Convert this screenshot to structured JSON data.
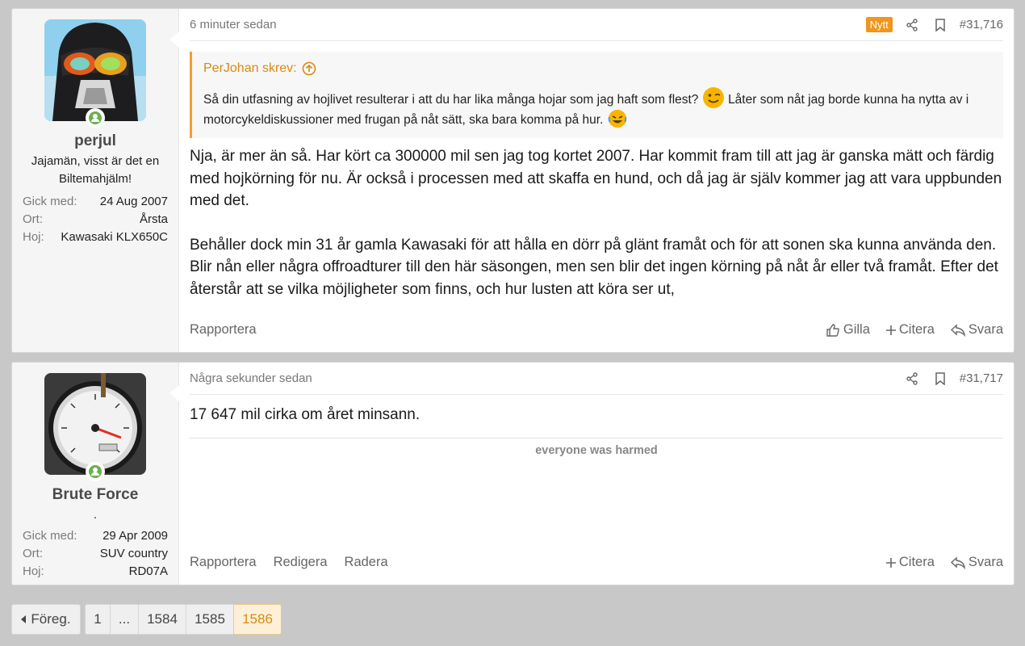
{
  "posts": [
    {
      "user": {
        "name": "perjul",
        "title": "Jajamän, visst är det en Biltemahjälm!",
        "extras": [
          {
            "label": "Gick med:",
            "value": "24 Aug 2007"
          },
          {
            "label": "Ort:",
            "value": "Årsta"
          },
          {
            "label": "Hoj:",
            "value": "Kawasaki KLX650C"
          }
        ]
      },
      "date": "6 minuter sedan",
      "badge": "Nytt",
      "number": "#31,716",
      "quote": {
        "author": "PerJohan skrev:",
        "text_1": "Så din utfasning av hojlivet resulterar i att du har lika många hojar som jag haft som flest?",
        "text_2": "Låter som nåt jag borde kunna ha nytta av i motorcykeldiskussioner med frugan på nåt sätt, ska bara komma på hur."
      },
      "paragraphs": [
        "Nja, är mer än så. Har kört ca 300000 mil sen jag tog kortet 2007. Har kommit fram till att jag är ganska mätt och färdig med hojkörning för nu. Är också i processen med att skaffa en hund, och då jag är själv kommer jag att vara uppbunden med det.",
        "Behåller dock min 31 år gamla Kawasaki för att hålla en dörr på glänt framåt och för att sonen ska kunna använda den. Blir nån eller några offroadturer till den här säsongen, men sen blir det ingen körning på nåt år eller två framåt. Efter det återstår att se vilka möjligheter som finns, och hur lusten att köra ser ut,"
      ],
      "actions_left": [
        "Rapportera"
      ],
      "actions_right": [
        "Gilla",
        "Citera",
        "Svara"
      ]
    },
    {
      "user": {
        "name": "Brute Force",
        "title": ".",
        "extras": [
          {
            "label": "Gick med:",
            "value": "29 Apr 2009"
          },
          {
            "label": "Ort:",
            "value": "SUV country"
          },
          {
            "label": "Hoj:",
            "value": "RD07A"
          }
        ]
      },
      "date": "Några sekunder sedan",
      "number": "#31,717",
      "text": "17 647 mil cirka om året minsann.",
      "signature": "everyone was harmed",
      "actions_left": [
        "Rapportera",
        "Redigera",
        "Radera"
      ],
      "actions_right": [
        "Citera",
        "Svara"
      ]
    }
  ],
  "pagination": {
    "prev": "Föreg.",
    "pages": [
      "1",
      "...",
      "1584",
      "1585",
      "1586"
    ],
    "current": "1586"
  },
  "colors": {
    "accent": "#f0961a",
    "online": "#6ab04c",
    "background": "#c8c8c8"
  }
}
